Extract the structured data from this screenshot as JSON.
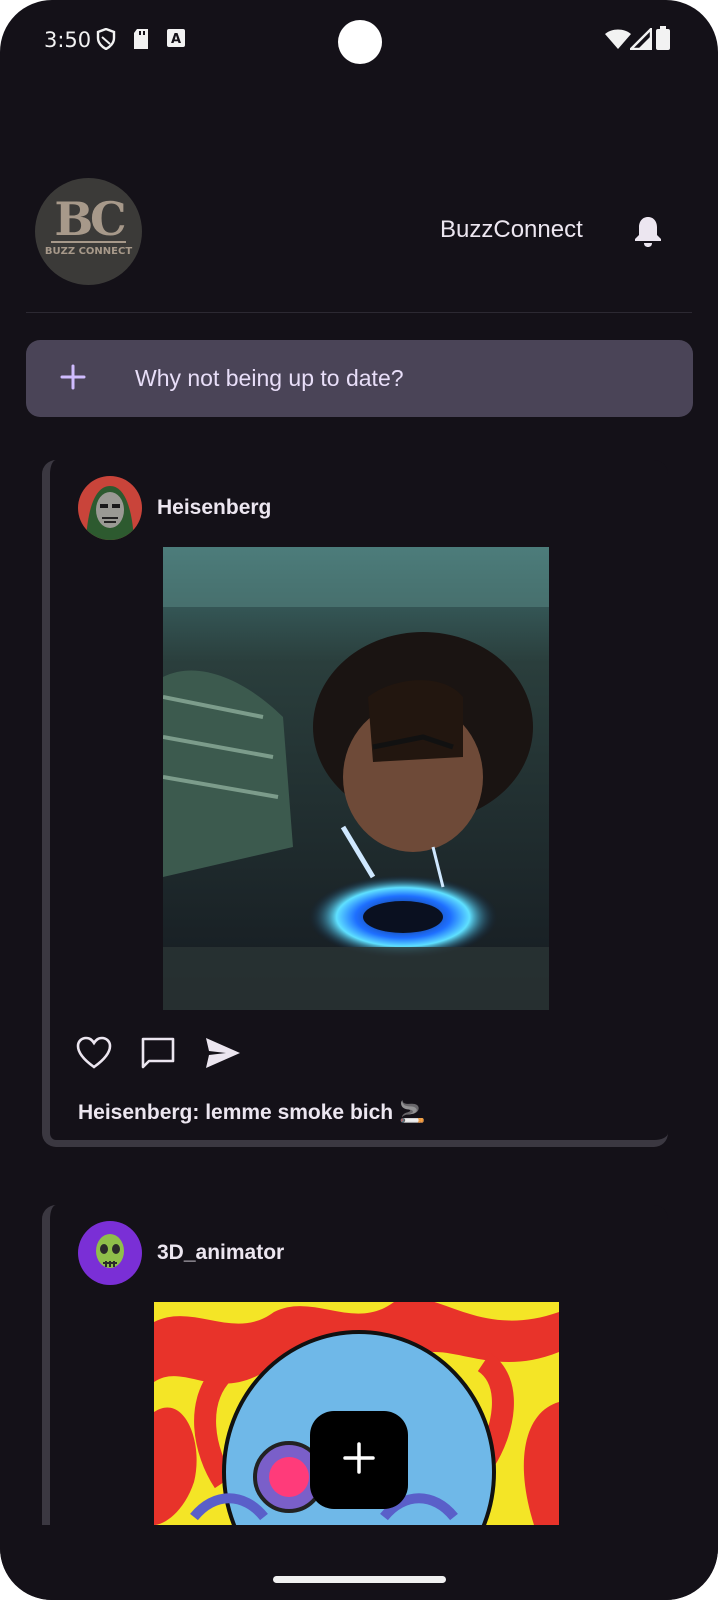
{
  "status_bar": {
    "time": "3:50",
    "icons": [
      "shield-icon",
      "sd-card-icon",
      "font-a-icon",
      "wifi-icon",
      "signal-icon",
      "battery-icon"
    ]
  },
  "header": {
    "logo": {
      "monogram": "BC",
      "subtext": "BUZZ CONNECT"
    },
    "title": "BuzzConnect",
    "notification_icon": "bell-icon"
  },
  "composer": {
    "icon": "plus-icon",
    "placeholder": "Why not being up to date?"
  },
  "posts": [
    {
      "username": "Heisenberg",
      "avatar_icon": "masked-villain-avatar",
      "image": "man-lighting-cigarette-on-stove-photo",
      "actions": [
        "heart-icon",
        "comment-icon",
        "send-icon"
      ],
      "caption": "Heisenberg: lemme smoke bich 🚬"
    },
    {
      "username": "3D_animator",
      "avatar_icon": "green-skull-avatar",
      "image": "psychedelic-skull-illustration"
    }
  ],
  "fab": {
    "icon": "plus-icon"
  },
  "colors": {
    "background": "#141118",
    "composer": "#4a4457",
    "accent": "#d0bcff",
    "text": "#ece6f0"
  }
}
